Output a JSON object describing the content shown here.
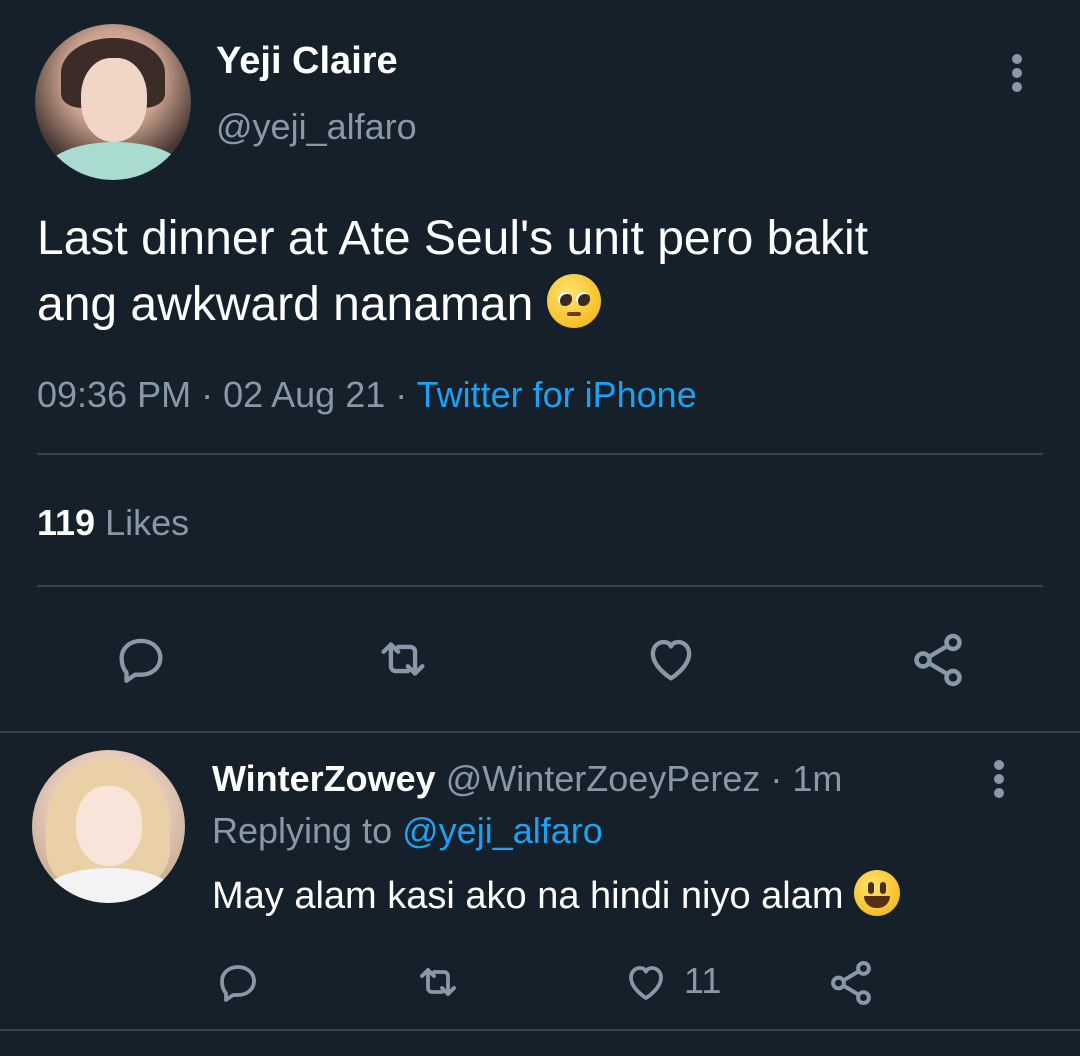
{
  "tweet": {
    "author_name": "Yeji Claire",
    "author_handle": "@yeji_alfaro",
    "text_line1": "Last dinner at Ate Seul's unit pero bakit",
    "text_line2": "ang awkward nanaman",
    "timestamp": "09:36 PM · 02 Aug 21",
    "separator": " · ",
    "source": "Twitter for iPhone",
    "likes_count": "119",
    "likes_label": "Likes",
    "icons": [
      "reply-icon",
      "retweet-icon",
      "like-icon",
      "share-icon",
      "more-options-icon",
      "pleading-face-emoji"
    ]
  },
  "reply": {
    "author_name": "WinterZowey",
    "author_handle": "@WinterZoeyPerez",
    "time": "· 1m",
    "replying_label": "Replying to",
    "replying_to": "@yeji_alfaro",
    "text": "May alam kasi ako na hindi niyo alam",
    "like_count": "11",
    "icons": [
      "reply-icon",
      "retweet-icon",
      "like-icon",
      "share-icon",
      "more-options-icon",
      "smiley-emoji"
    ]
  },
  "colors": {
    "background": "#15202b",
    "primary_text": "#ffffff",
    "secondary_text": "#8899a6",
    "accent": "#1da1f2",
    "divider": "#38444d"
  }
}
